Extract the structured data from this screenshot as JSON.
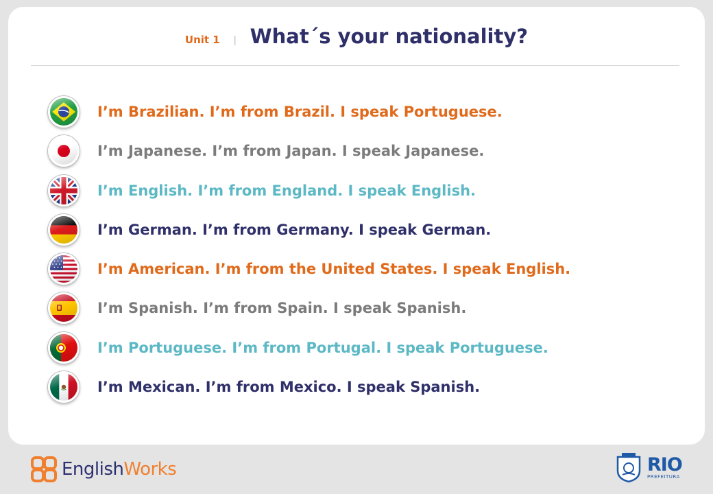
{
  "header": {
    "unit_label": "Unit 1",
    "separator": "|",
    "title": "What´s your nationality?"
  },
  "colors": {
    "orange": "#e06a1b",
    "gray": "#7b7b7b",
    "teal": "#5bb8c4",
    "navy": "#2f2f6a"
  },
  "rows": [
    {
      "flag": "brazil-flag-icon",
      "text": "I’m Brazilian. I’m from Brazil. I speak Portuguese.",
      "color": "#e06a1b"
    },
    {
      "flag": "japan-flag-icon",
      "text": "I’m Japanese. I’m from Japan. I speak Japanese.",
      "color": "#7b7b7b"
    },
    {
      "flag": "uk-flag-icon",
      "text": "I’m English. I’m from England. I speak English.",
      "color": "#5bb8c4"
    },
    {
      "flag": "germany-flag-icon",
      "text": "I’m German. I’m from Germany. I speak German.",
      "color": "#2f2f6a"
    },
    {
      "flag": "usa-flag-icon",
      "text": "I’m American. I’m from the United States. I speak English.",
      "color": "#e06a1b"
    },
    {
      "flag": "spain-flag-icon",
      "text": "I’m Spanish. I’m from Spain. I speak Spanish.",
      "color": "#7b7b7b"
    },
    {
      "flag": "portugal-flag-icon",
      "text": "I’m Portuguese. I’m from Portugal. I speak Portuguese.",
      "color": "#5bb8c4"
    },
    {
      "flag": "mexico-flag-icon",
      "text": "I’m Mexican. I’m from Mexico. I speak Spanish.",
      "color": "#2f2f6a"
    }
  ],
  "footer": {
    "englishworks_part1": "English",
    "englishworks_part2": "Works",
    "rio_big": "RIO",
    "rio_small": "PREFEITURA"
  }
}
